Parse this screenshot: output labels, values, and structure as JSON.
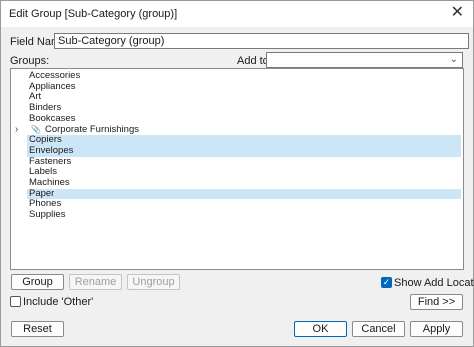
{
  "window": {
    "title": "Edit Group [Sub-Category (group)]",
    "close_glyph": "✕"
  },
  "field_name": {
    "label": "Field Name:",
    "value": "Sub-Category (group)"
  },
  "groups_label": "Groups:",
  "add_to": {
    "label": "Add to:",
    "value": ""
  },
  "tree": {
    "items": [
      {
        "label": "Accessories",
        "selected": false
      },
      {
        "label": "Appliances",
        "selected": false
      },
      {
        "label": "Art",
        "selected": false
      },
      {
        "label": "Binders",
        "selected": false
      },
      {
        "label": "Bookcases",
        "selected": false
      },
      {
        "label": "Corporate Furnishings",
        "selected": false,
        "is_group": true,
        "icon": "paperclip-icon"
      },
      {
        "label": "Copiers",
        "selected": true
      },
      {
        "label": "Envelopes",
        "selected": true
      },
      {
        "label": "Fasteners",
        "selected": false
      },
      {
        "label": "Labels",
        "selected": false
      },
      {
        "label": "Machines",
        "selected": false
      },
      {
        "label": "Paper",
        "selected": true
      },
      {
        "label": "Phones",
        "selected": false
      },
      {
        "label": "Supplies",
        "selected": false
      }
    ]
  },
  "buttons": {
    "group": "Group",
    "rename": "Rename",
    "ungroup": "Ungroup",
    "find": "Find >>",
    "reset": "Reset",
    "ok": "OK",
    "cancel": "Cancel",
    "apply": "Apply"
  },
  "checkboxes": {
    "show_add_location": {
      "label": "Show Add Location",
      "checked": true
    },
    "include_other": {
      "label": "Include 'Other'",
      "checked": false
    }
  },
  "colors": {
    "selection": "#cde6f7",
    "accent": "#0067c0"
  }
}
